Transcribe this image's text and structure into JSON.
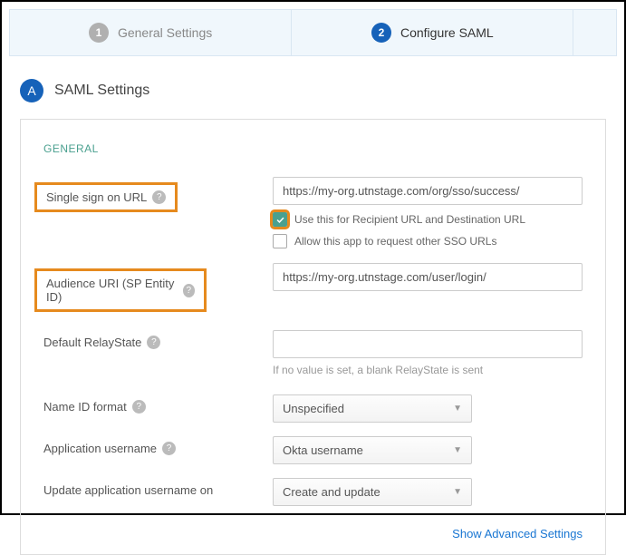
{
  "progress": {
    "step1_num": "1",
    "step1_label": "General Settings",
    "step2_num": "2",
    "step2_label": "Configure SAML"
  },
  "section": {
    "badge": "A",
    "title": "SAML Settings"
  },
  "group_title": "GENERAL",
  "fields": {
    "sso_url": {
      "label": "Single sign on URL",
      "value": "https://my-org.utnstage.com/org/sso/success/"
    },
    "checkbox1_label": "Use this for Recipient URL and Destination URL",
    "checkbox2_label": "Allow this app to request other SSO URLs",
    "audience": {
      "label": "Audience URI (SP Entity ID)",
      "value": "https://my-org.utnstage.com/user/login/"
    },
    "relay_state": {
      "label": "Default RelayState",
      "value": "",
      "hint": "If no value is set, a blank RelayState is sent"
    },
    "name_id": {
      "label": "Name ID format",
      "value": "Unspecified"
    },
    "app_username": {
      "label": "Application username",
      "value": "Okta username"
    },
    "update_on": {
      "label": "Update application username on",
      "value": "Create and update"
    }
  },
  "advanced_link": "Show Advanced Settings",
  "help": "?"
}
